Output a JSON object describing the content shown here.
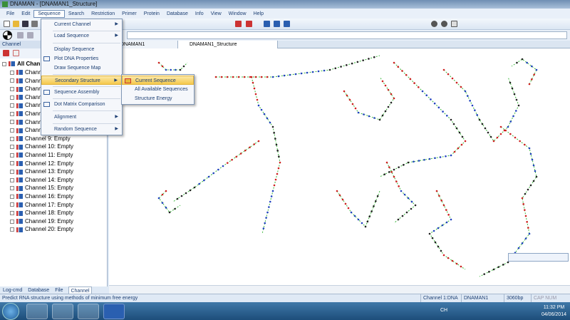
{
  "window": {
    "title": "DNAMAN - [DNAMAN1_Structure]"
  },
  "menubar": [
    "File",
    "Edit",
    "Sequence",
    "Search",
    "Restriction",
    "Primer",
    "Protein",
    "Database",
    "Info",
    "View",
    "Window",
    "Help"
  ],
  "left_panel": {
    "header": "Channel",
    "root": "All Channels",
    "channels": [
      "Channel 1",
      "Channel 2",
      "Channel 3",
      "Channel 4",
      "Channel 5",
      "Channel 6",
      "Channel 7",
      "Channel 8",
      "Channel 9: Empty",
      "Channel 10: Empty",
      "Channel 11: Empty",
      "Channel 12: Empty",
      "Channel 13: Empty",
      "Channel 14: Empty",
      "Channel 15: Empty",
      "Channel 16: Empty",
      "Channel 17: Empty",
      "Channel 18: Empty",
      "Channel 19: Empty",
      "Channel 20: Empty"
    ],
    "tabs": [
      "Log-cmd",
      "Database",
      "File",
      "Channel"
    ],
    "active_tab": "Channel"
  },
  "doc_tabs": [
    "DNAMAN1",
    "DNAMAN1_Structure"
  ],
  "sequence_menu": {
    "items": [
      "Current Channel",
      "Load Sequence",
      "Display Sequence",
      "Plot DNA Properties",
      "Draw Sequence Map",
      "Secondary Structure",
      "Sequence Assembly",
      "Dot Matrix Comparison",
      "Alignment",
      "Random Sequence"
    ],
    "highlighted": "Secondary Structure"
  },
  "secondary_structure_submenu": {
    "items": [
      "Current Sequence",
      "All Available Sequences",
      "Structure Energy"
    ],
    "highlighted": "Current Sequence"
  },
  "statusbar": {
    "message": "Predict RNA structure using methods of minimum free energy",
    "channel": "Channel 1:DNA",
    "doc": "DNAMAN1",
    "length": "3060bp",
    "keys": "CAP NUM SCRL"
  },
  "taskbar": {
    "time": "11:32 PM",
    "date": "04/06/2014",
    "lang": "CH"
  },
  "colors": {
    "highlight": "#f5c94c",
    "base_pair_line": "#3db83d",
    "base_G": "#d02020",
    "base_C": "#2040c0",
    "base_A": "#222222"
  }
}
